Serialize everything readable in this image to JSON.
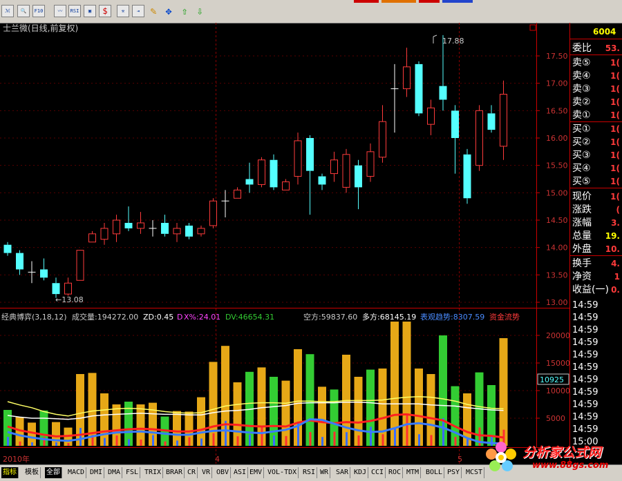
{
  "toolbar": {
    "icons": [
      {
        "name": "draw-icon",
        "glyph": "ℳ"
      },
      {
        "name": "zoom-icon",
        "glyph": "🔍"
      },
      {
        "name": "f10-icon",
        "glyph": "F10"
      },
      {
        "name": "chart-icon",
        "glyph": "〰"
      },
      {
        "name": "rsi-icon",
        "glyph": "RSI"
      },
      {
        "name": "window-icon",
        "glyph": "▣"
      },
      {
        "name": "money-icon",
        "glyph": "$"
      },
      {
        "name": "link-icon",
        "glyph": "⚒"
      },
      {
        "name": "export-icon",
        "glyph": "⇥"
      },
      {
        "name": "pen-icon",
        "glyph": "✎"
      },
      {
        "name": "move-icon",
        "glyph": "✥"
      },
      {
        "name": "arrow-up-icon",
        "glyph": "⇧"
      },
      {
        "name": "arrow-down-icon",
        "glyph": "⇩"
      }
    ]
  },
  "main": {
    "title": "士兰微(日线,前复权)",
    "max_label": "17.88",
    "min_label": "←13.08",
    "y_ticks": [
      "17.50",
      "17.00",
      "16.50",
      "16.00",
      "15.50",
      "15.00",
      "14.50",
      "14.00",
      "13.50",
      "13.00"
    ]
  },
  "indicator": {
    "title": "经典博弈(3,18,12)",
    "volume": "成交量:194272.00",
    "zd": "ZD:0.45",
    "d_label": "D",
    "x_pct": "X%:24.01",
    "dv": "DV:46654.31",
    "kong": "空方:59837.60",
    "duo": "多方:68145.19",
    "trend": "表观趋势:8307.59",
    "flow": "资金流势",
    "y_ticks": [
      "20000",
      "15000",
      "10000",
      "5000"
    ],
    "current": "10925"
  },
  "side": {
    "code": "6004",
    "rows": [
      {
        "label": "委比",
        "value": "53."
      },
      {
        "label": "卖⑤",
        "value": "1("
      },
      {
        "label": "卖④",
        "value": "1("
      },
      {
        "label": "卖③",
        "value": "1("
      },
      {
        "label": "卖②",
        "value": "1("
      },
      {
        "label": "卖①",
        "value": "1("
      },
      {
        "label": "买①",
        "value": "1("
      },
      {
        "label": "买②",
        "value": "1("
      },
      {
        "label": "买③",
        "value": "1("
      },
      {
        "label": "买④",
        "value": "1("
      },
      {
        "label": "买⑤",
        "value": "1("
      },
      {
        "label": "现价",
        "value": "1("
      },
      {
        "label": "涨跌",
        "value": "("
      },
      {
        "label": "涨幅",
        "value": "3."
      },
      {
        "label": "总量",
        "value": "19."
      },
      {
        "label": "外盘",
        "value": "10."
      },
      {
        "label": "换手",
        "value": "4."
      },
      {
        "label": "净资",
        "value": "1"
      },
      {
        "label": "收益(一)",
        "value": "0."
      }
    ],
    "times": [
      "14:59",
      "14:59",
      "14:59",
      "14:59",
      "14:59",
      "14:59",
      "14:59",
      "14:59",
      "14:59",
      "14:59",
      "14:59",
      "15:00"
    ]
  },
  "dates": {
    "d1": "2010年",
    "d2": "4",
    "d3": "5"
  },
  "tabs": [
    "指标",
    "模板",
    "全部",
    "MACD",
    "DMI",
    "DMA",
    "FSL",
    "TRIX",
    "BRAR",
    "CR",
    "VR",
    "OBV",
    "ASI",
    "EMV",
    "VOL-TDX",
    "RSI",
    "WR",
    "SAR",
    "KDJ",
    "CCI",
    "ROC",
    "MTM",
    "BOLL",
    "PSY",
    "MCST"
  ],
  "watermark": {
    "text": "分析家公式网",
    "url": "www.88gs.com"
  },
  "colors": {
    "up": "#ff3b3b",
    "down": "#54ffff",
    "axis": "#cc0000",
    "grid": "#8b0000",
    "yellow": "#ffff00",
    "green": "#33cc33",
    "orange": "#e6a817"
  },
  "chart_data": {
    "type": "candlestick",
    "ylim": [
      12.9,
      17.9
    ],
    "candles": [
      [
        14.05,
        13.9,
        14.1,
        13.85
      ],
      [
        13.9,
        13.6,
        13.95,
        13.5
      ],
      [
        13.55,
        13.55,
        13.75,
        13.35
      ],
      [
        13.6,
        13.45,
        13.8,
        13.4
      ],
      [
        13.35,
        13.15,
        13.45,
        13.08
      ],
      [
        13.15,
        13.35,
        13.45,
        13.12
      ],
      [
        13.4,
        13.95,
        13.95,
        13.4
      ],
      [
        14.1,
        14.25,
        14.3,
        14.1
      ],
      [
        14.15,
        14.35,
        14.45,
        14.05
      ],
      [
        14.25,
        14.5,
        14.6,
        14.1
      ],
      [
        14.45,
        14.35,
        14.75,
        14.3
      ],
      [
        14.35,
        14.45,
        14.65,
        14.25
      ],
      [
        14.35,
        14.35,
        14.5,
        14.2
      ],
      [
        14.45,
        14.25,
        14.6,
        14.2
      ],
      [
        14.25,
        14.35,
        14.45,
        14.1
      ],
      [
        14.4,
        14.2,
        14.45,
        14.15
      ],
      [
        14.25,
        14.35,
        14.4,
        14.2
      ],
      [
        14.4,
        14.85,
        14.9,
        14.35
      ],
      [
        14.85,
        14.85,
        15.05,
        14.55
      ],
      [
        14.9,
        15.05,
        15.1,
        14.9
      ],
      [
        15.25,
        15.15,
        15.55,
        15.0
      ],
      [
        15.15,
        15.6,
        15.65,
        15.1
      ],
      [
        15.6,
        15.1,
        15.7,
        15.05
      ],
      [
        15.05,
        15.2,
        15.25,
        15.05
      ],
      [
        15.3,
        15.95,
        16.1,
        15.15
      ],
      [
        16.0,
        15.4,
        16.05,
        14.6
      ],
      [
        15.3,
        15.15,
        15.35,
        15.05
      ],
      [
        15.35,
        15.6,
        15.75,
        15.2
      ],
      [
        15.1,
        15.7,
        15.8,
        15.0
      ],
      [
        15.5,
        15.1,
        15.6,
        14.7
      ],
      [
        15.3,
        15.75,
        15.9,
        15.2
      ],
      [
        15.65,
        16.3,
        16.6,
        15.55
      ],
      [
        16.9,
        16.9,
        17.35,
        16.1
      ],
      [
        16.9,
        17.3,
        17.65,
        16.75
      ],
      [
        17.35,
        16.45,
        17.4,
        16.4
      ],
      [
        16.25,
        16.55,
        16.7,
        16.05
      ],
      [
        16.95,
        16.7,
        17.88,
        16.5
      ],
      [
        16.5,
        16.0,
        16.6,
        15.35
      ],
      [
        15.7,
        14.9,
        15.8,
        14.8
      ],
      [
        15.5,
        16.5,
        16.6,
        15.4
      ],
      [
        16.45,
        16.15,
        16.6,
        16.1
      ],
      [
        15.85,
        16.8,
        17.05,
        15.6
      ]
    ],
    "volume": [
      {
        "v": 6500,
        "c": "g"
      },
      {
        "v": 5200,
        "c": "o"
      },
      {
        "v": 4200,
        "c": "o"
      },
      {
        "v": 6400,
        "c": "g"
      },
      {
        "v": 4300,
        "c": "o"
      },
      {
        "v": 3300,
        "c": "o"
      },
      {
        "v": 13000,
        "c": "o"
      },
      {
        "v": 13200,
        "c": "o"
      },
      {
        "v": 9500,
        "c": "o"
      },
      {
        "v": 7500,
        "c": "o"
      },
      {
        "v": 8000,
        "c": "g"
      },
      {
        "v": 7500,
        "c": "o"
      },
      {
        "v": 7800,
        "c": "o"
      },
      {
        "v": 5300,
        "c": "g"
      },
      {
        "v": 6300,
        "c": "o"
      },
      {
        "v": 6200,
        "c": "o"
      },
      {
        "v": 8800,
        "c": "o"
      },
      {
        "v": 15200,
        "c": "o"
      },
      {
        "v": 18100,
        "c": "o"
      },
      {
        "v": 11500,
        "c": "o"
      },
      {
        "v": 13400,
        "c": "g"
      },
      {
        "v": 14200,
        "c": "o"
      },
      {
        "v": 12500,
        "c": "g"
      },
      {
        "v": 11800,
        "c": "o"
      },
      {
        "v": 17500,
        "c": "o"
      },
      {
        "v": 16600,
        "c": "g"
      },
      {
        "v": 10700,
        "c": "o"
      },
      {
        "v": 10200,
        "c": "g"
      },
      {
        "v": 16500,
        "c": "o"
      },
      {
        "v": 12500,
        "c": "o"
      },
      {
        "v": 13800,
        "c": "g"
      },
      {
        "v": 14000,
        "c": "o"
      },
      {
        "v": 22500,
        "c": "o"
      },
      {
        "v": 22500,
        "c": "o"
      },
      {
        "v": 14000,
        "c": "o"
      },
      {
        "v": 13000,
        "c": "o"
      },
      {
        "v": 20000,
        "c": "g"
      },
      {
        "v": 10800,
        "c": "g"
      },
      {
        "v": 9500,
        "c": "o"
      },
      {
        "v": 13300,
        "c": "g"
      },
      {
        "v": 11000,
        "c": "g"
      },
      {
        "v": 19500,
        "c": "o"
      }
    ],
    "white_line": [
      5500,
      5200,
      5000,
      5000,
      4900,
      4800,
      5000,
      5400,
      5600,
      5700,
      5800,
      5900,
      5800,
      5700,
      5700,
      5600,
      5600,
      6000,
      6300,
      6400,
      6600,
      6900,
      7100,
      7300,
      7700,
      7800,
      7800,
      7800,
      7900,
      7900,
      7800,
      7600,
      7600,
      7600,
      7600,
      7400,
      7300,
      7200,
      6900,
      6700,
      6500,
      6400
    ],
    "yellow_line": [
      8000,
      7400,
      6900,
      6200,
      5700,
      5400,
      5900,
      6300,
      6500,
      6700,
      6800,
      6700,
      6500,
      6200,
      6000,
      5900,
      6000,
      6600,
      7200,
      7500,
      7700,
      7800,
      7800,
      7700,
      8100,
      8100,
      8000,
      8000,
      8200,
      8200,
      8200,
      8300,
      8600,
      8800,
      8900,
      8800,
      8500,
      8100,
      7500,
      7100,
      6800,
      6700
    ],
    "red_line": [
      3500,
      2800,
      2400,
      2000,
      1700,
      1800,
      2000,
      2300,
      2600,
      2800,
      3000,
      3100,
      3000,
      2800,
      2600,
      2600,
      2900,
      3500,
      3900,
      3800,
      3600,
      3500,
      3600,
      3500,
      4200,
      4600,
      4300,
      4100,
      4300,
      4200,
      4500,
      5000,
      5600,
      5700,
      5400,
      5000,
      4600,
      3500,
      2500,
      1900,
      1800,
      1500
    ],
    "blue_line": [
      2500,
      1900,
      1500,
      1200,
      1000,
      900,
      1200,
      1700,
      2100,
      2400,
      2500,
      2600,
      2400,
      2200,
      2000,
      2000,
      2400,
      2700,
      2800,
      2600,
      2400,
      2300,
      2600,
      2900,
      3600,
      4800,
      4700,
      4000,
      3300,
      2800,
      2500,
      2600,
      3200,
      3900,
      4100,
      3800,
      3300,
      2400,
      1400,
      700,
      500,
      400
    ]
  }
}
